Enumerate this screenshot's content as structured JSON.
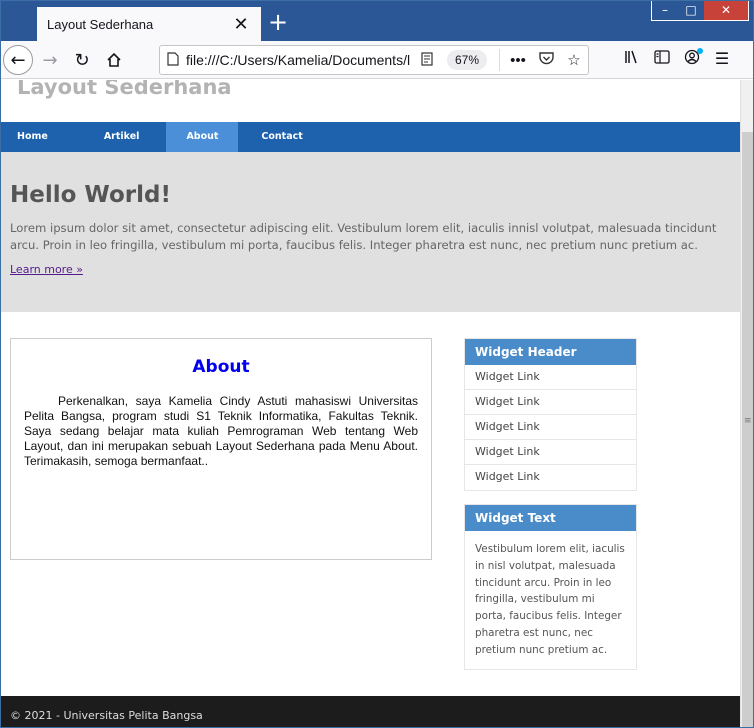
{
  "browser": {
    "tab_title": "Layout Sederhana",
    "tab_close": "✕",
    "new_tab": "+",
    "url": "file:///C:/Users/Kamelia/Documents/l",
    "zoom": "67%",
    "window_controls": {
      "minimize": "–",
      "maximize": "□",
      "close": "✕"
    }
  },
  "page": {
    "site_title": "Layout Sederhana",
    "nav": [
      {
        "label": "Home"
      },
      {
        "label": "Artikel"
      },
      {
        "label": "About",
        "active": true
      },
      {
        "label": "Contact"
      }
    ],
    "hero": {
      "heading": "Hello World!",
      "body": "Lorem ipsum dolor sit amet, consectetur adipiscing elit. Vestibulum lorem elit, iaculis innisl volutpat, malesuada tincidunt arcu. Proin in leo fringilla, vestibulum mi porta, faucibus felis. Integer pharetra est nunc, nec pretium nunc pretium ac.",
      "link": "Learn more »"
    },
    "about": {
      "heading": "About",
      "body": "Perkenalkan, saya Kamelia Cindy Astuti mahasiswi Universitas Pelita Bangsa, program studi S1 Teknik Informatika, Fakultas Teknik. Saya sedang belajar mata kuliah Pemrograman Web tentang Web Layout, dan ini merupakan sebuah Layout Sederhana pada Menu About. Terimakasih, semoga bermanfaat.."
    },
    "widget_links": {
      "header": "Widget Header",
      "links": [
        "Widget Link",
        "Widget Link",
        "Widget Link",
        "Widget Link",
        "Widget Link"
      ]
    },
    "widget_text": {
      "header": "Widget Text",
      "body": "Vestibulum lorem elit, iaculis in nisl volutpat, malesuada tincidunt arcu. Proin in leo fringilla, vestibulum mi porta, faucibus felis. Integer pharetra est nunc, nec pretium nunc pretium ac."
    },
    "footer": "© 2021 - Universitas Pelita Bangsa"
  },
  "colors": {
    "nav_bg": "#1e62ad",
    "nav_active": "#4a8fd8",
    "hero_bg": "#e0e0e0",
    "widget_header": "#4a8cca",
    "footer_bg": "#1c1c1c",
    "titlebar": "#2b5797"
  },
  "icons": [
    "back-icon",
    "forward-icon",
    "reload-icon",
    "home-icon",
    "page-icon",
    "reader-view-icon",
    "more-icon",
    "pocket-icon",
    "bookmark-star-icon",
    "library-icon",
    "sidebar-icon",
    "account-icon",
    "menu-icon"
  ]
}
